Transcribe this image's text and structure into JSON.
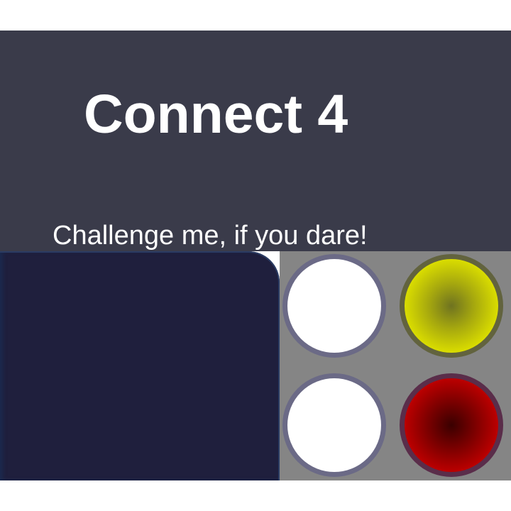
{
  "header": {
    "title": "Connect 4",
    "tagline": "Challenge me, if you dare!"
  },
  "board": {
    "colors": {
      "board": "#858585",
      "empty": "#ffffff",
      "yellow": "#d9dc00",
      "red": "#c40000"
    },
    "rows": [
      [
        "empty",
        "yellow"
      ],
      [
        "empty",
        "red"
      ]
    ]
  },
  "colors": {
    "header_bg": "#3a3b4a",
    "panel_bg": "#1f1f3d",
    "text": "#ffffff"
  }
}
